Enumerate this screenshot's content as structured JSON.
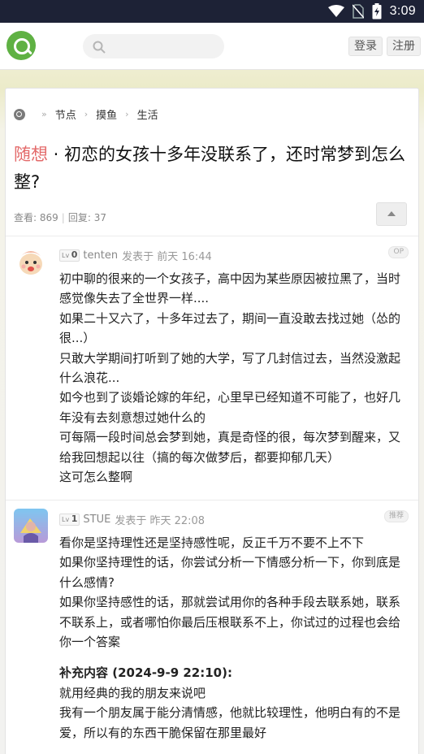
{
  "status": {
    "time": "3:09"
  },
  "nav": {
    "search_placeholder": "",
    "login": "登录",
    "register": "注册"
  },
  "breadcrumb": [
    "节点",
    "摸鱼",
    "生活"
  ],
  "post": {
    "tag": "随想",
    "title": "初恋的女孩十多年没联系了，还时常梦到怎么整?",
    "views_label": "查看:",
    "views": "869",
    "replies_label": "回复:",
    "replies": "37"
  },
  "replies": [
    {
      "level": "0",
      "user": "tenten",
      "time": "发表于 前天 16:44",
      "badge": "OP",
      "lines": [
        "初中聊的很来的一个女孩子，高中因为某些原因被拉黑了，当时感觉像失去了全世界一样....",
        "如果二十又六了，十多年过去了，期间一直没敢去找过她（怂的很...）",
        "只敢大学期间打听到了她的大学，写了几封信过去，当然没激起什么浪花...",
        "如今也到了谈婚论嫁的年纪，心里早已经知道不可能了，也好几年没有去刻意想过她什么的",
        "可每隔一段时间总会梦到她，真是奇怪的很，每次梦到醒来，又给我回想起以往（搞的每次做梦后，都要抑郁几天）",
        "这可怎么整啊"
      ]
    },
    {
      "level": "1",
      "user": "STUE",
      "time": "发表于 昨天 22:08",
      "badge": "推荐",
      "lines": [
        "看你是坚持理性还是坚持感性呢，反正千万不要不上不下",
        "如果你坚持理性的话，你尝试分析一下情感分析一下，你到底是什么感情?",
        "如果你坚持感性的话，那就尝试用你的各种手段去联系她，联系不联系上，或者哪怕你最后压根联系不上，你试过的过程也会给你一个答案"
      ],
      "supplement_title": "补充内容 (2024-9-9 22:10):",
      "supplement_lines": [
        "就用经典的我的朋友来说吧",
        "我有一个朋友属于能分清情感，他就比较理性，他明白有的不是爱，所以有的东西干脆保留在那里最好"
      ]
    }
  ]
}
